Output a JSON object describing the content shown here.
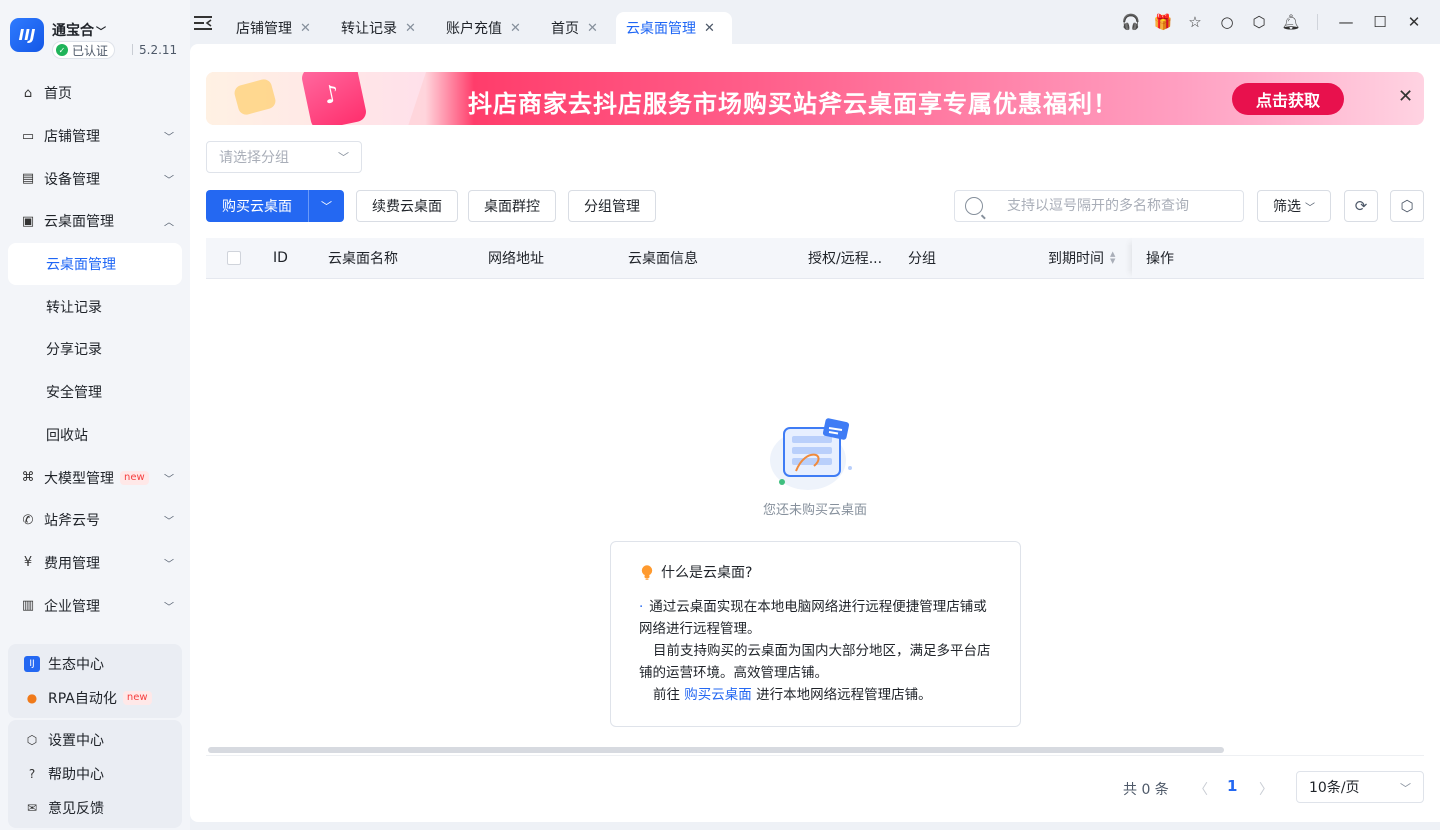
{
  "app": {
    "name": "通宝合",
    "verified_label": "已认证",
    "version": "5.2.11"
  },
  "sidebar": {
    "items": [
      {
        "label": "首页"
      },
      {
        "label": "店铺管理"
      },
      {
        "label": "设备管理"
      },
      {
        "label": "云桌面管理"
      },
      {
        "label": "云桌面管理"
      },
      {
        "label": "转让记录"
      },
      {
        "label": "分享记录"
      },
      {
        "label": "安全管理"
      },
      {
        "label": "回收站"
      },
      {
        "label": "大模型管理",
        "badge": "new"
      },
      {
        "label": "站斧云号"
      },
      {
        "label": "费用管理"
      },
      {
        "label": "企业管理"
      }
    ],
    "panel1": [
      {
        "label": "生态中心"
      },
      {
        "label": "RPA自动化",
        "badge": "new"
      }
    ],
    "panel2": [
      {
        "label": "设置中心"
      },
      {
        "label": "帮助中心"
      },
      {
        "label": "意见反馈"
      }
    ]
  },
  "tabs": [
    {
      "label": "店铺管理"
    },
    {
      "label": "转让记录"
    },
    {
      "label": "账户充值"
    },
    {
      "label": "首页"
    },
    {
      "label": "云桌面管理",
      "active": true
    }
  ],
  "banner": {
    "text": "抖店商家去抖店服务市场购买站斧云桌面享专属优惠福利！",
    "button": "点击获取"
  },
  "toolbar": {
    "group_placeholder": "请选择分组",
    "buy_label": "购买云桌面",
    "renew_label": "续费云桌面",
    "group_control_label": "桌面群控",
    "group_manage_label": "分组管理",
    "search_placeholder": "支持以逗号隔开的多名称查询",
    "filter_label": "筛选"
  },
  "table": {
    "columns": [
      "ID",
      "云桌面名称",
      "网络地址",
      "云桌面信息",
      "授权/远程...",
      "分组",
      "到期时间",
      "操作"
    ]
  },
  "empty": {
    "text": "您还未购买云桌面"
  },
  "info": {
    "title": "什么是云桌面?",
    "line1": "通过云桌面实现在本地电脑网络进行远程便捷管理店铺或网络进行远程管理。",
    "line2": "目前支持购买的云桌面为国内大部分地区，满足多平台店铺的运营环境。高效管理店铺。",
    "line3_prefix": "前往",
    "line3_link": "购买云桌面",
    "line3_suffix": "进行本地网络远程管理店铺。"
  },
  "pagination": {
    "total": "共 0 条",
    "current": "1",
    "page_size": "10条/页"
  },
  "colors": {
    "primary": "#2468f2",
    "banner_button": "#e8114d",
    "verified": "#20b45a"
  }
}
